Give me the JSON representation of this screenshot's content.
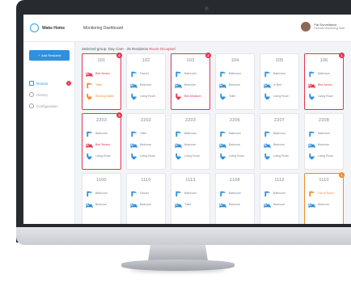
{
  "colors": {
    "accent": "#2f90dd",
    "alert": "#e8344e",
    "warning": "#f28a2b"
  },
  "header": {
    "logo_text": "Wake Home",
    "title": "Monitoring Dashboard",
    "user_name": "Pat Surveilance",
    "user_role": "Remote Monitoring Staff"
  },
  "sidebar": {
    "add_button": "Add Resident",
    "items": [
      {
        "label": "Rooms",
        "badge": "1",
        "icon": "grid-icon"
      },
      {
        "label": "History",
        "icon": "clock-icon"
      },
      {
        "label": "Configuration",
        "icon": "gear-icon"
      }
    ]
  },
  "main": {
    "filter_text": "Selected group: Day Care · 25 Residents",
    "filter_link": "Room Occupied"
  },
  "rooms": [
    {
      "number": "101",
      "status": "alert",
      "badge": "3",
      "devices": [
        {
          "icon": "bed-icon",
          "label": "Bed Sensor",
          "tone": "red"
        },
        {
          "icon": "faucet-icon",
          "label": "Toilet",
          "tone": "orange"
        },
        {
          "icon": "toilet-icon",
          "label": "Running Water",
          "tone": "orange"
        }
      ]
    },
    {
      "number": "102",
      "status": "normal",
      "devices": [
        {
          "icon": "faucet-icon",
          "label": "Faucet"
        },
        {
          "icon": "bed-icon",
          "label": "Bedroom"
        },
        {
          "icon": "toilet-icon",
          "label": "Living Room"
        }
      ]
    },
    {
      "number": "103",
      "status": "alert",
      "badge": "2",
      "devices": [
        {
          "icon": "faucet-icon",
          "label": "Bathroom"
        },
        {
          "icon": "bed-icon",
          "label": "Bedroom"
        },
        {
          "icon": "toilet-icon",
          "label": "Bed Moisture",
          "tone": "red"
        }
      ]
    },
    {
      "number": "104",
      "status": "normal",
      "devices": [
        {
          "icon": "faucet-icon",
          "label": "Bathroom"
        },
        {
          "icon": "bed-icon",
          "label": "Bedroom"
        },
        {
          "icon": "toilet-icon",
          "label": "Toilet"
        }
      ]
    },
    {
      "number": "105",
      "status": "normal",
      "devices": [
        {
          "icon": "faucet-icon",
          "label": "Bathroom"
        },
        {
          "icon": "bed-icon",
          "label": "In Bed"
        },
        {
          "icon": "toilet-icon",
          "label": "Living Room"
        }
      ]
    },
    {
      "number": "106",
      "status": "alert",
      "badge": "1",
      "devices": [
        {
          "icon": "faucet-icon",
          "label": "Bathroom"
        },
        {
          "icon": "bed-icon",
          "label": "Bed Sensor",
          "tone": "red"
        },
        {
          "icon": "toilet-icon",
          "label": "Living Room"
        }
      ]
    },
    {
      "number": "2203",
      "status": "alert",
      "badge": "2",
      "devices": [
        {
          "icon": "faucet-icon",
          "label": "Bathroom"
        },
        {
          "icon": "bed-icon",
          "label": "Bed Sensor",
          "tone": "red"
        },
        {
          "icon": "toilet-icon",
          "label": "Living Room"
        }
      ]
    },
    {
      "number": "2202",
      "status": "normal",
      "devices": [
        {
          "icon": "faucet-icon",
          "label": "Toilet"
        },
        {
          "icon": "bed-icon",
          "label": "Bedroom"
        },
        {
          "icon": "toilet-icon",
          "label": "Living Room"
        }
      ]
    },
    {
      "number": "2203",
      "status": "normal",
      "devices": [
        {
          "icon": "faucet-icon",
          "label": "Bathroom"
        },
        {
          "icon": "bed-icon",
          "label": "Bedroom"
        },
        {
          "icon": "toilet-icon",
          "label": "Living Room"
        }
      ]
    },
    {
      "number": "2206",
      "status": "normal",
      "devices": [
        {
          "icon": "faucet-icon",
          "label": "Bathroom"
        },
        {
          "icon": "bed-icon",
          "label": "Bedroom"
        },
        {
          "icon": "toilet-icon",
          "label": "Living Room"
        }
      ]
    },
    {
      "number": "2207",
      "status": "normal",
      "devices": [
        {
          "icon": "faucet-icon",
          "label": "Bathroom"
        },
        {
          "icon": "bed-icon",
          "label": "Bedroom"
        },
        {
          "icon": "toilet-icon",
          "label": "Living Room"
        }
      ]
    },
    {
      "number": "2208",
      "status": "normal",
      "devices": [
        {
          "icon": "faucet-icon",
          "label": "Bathroom"
        },
        {
          "icon": "bed-icon",
          "label": "Bedroom"
        },
        {
          "icon": "toilet-icon",
          "label": "Living Room"
        }
      ]
    },
    {
      "number": "1100",
      "status": "normal",
      "devices": [
        {
          "icon": "faucet-icon",
          "label": "Bathroom"
        },
        {
          "icon": "bed-icon",
          "label": "Bedroom"
        }
      ]
    },
    {
      "number": "1110",
      "status": "normal",
      "devices": [
        {
          "icon": "faucet-icon",
          "label": "Faucet"
        },
        {
          "icon": "bed-icon",
          "label": "Bedroom"
        }
      ]
    },
    {
      "number": "1113",
      "status": "normal",
      "devices": [
        {
          "icon": "faucet-icon",
          "label": "Bathroom"
        },
        {
          "icon": "bed-icon",
          "label": "Toilet"
        }
      ]
    },
    {
      "number": "1108",
      "status": "normal",
      "devices": [
        {
          "icon": "faucet-icon",
          "label": "Bathroom"
        },
        {
          "icon": "bed-icon",
          "label": "Bedroom"
        }
      ]
    },
    {
      "number": "1112",
      "status": "normal",
      "devices": [
        {
          "icon": "faucet-icon",
          "label": "Bathroom"
        },
        {
          "icon": "bed-icon",
          "label": "Bedroom"
        }
      ]
    },
    {
      "number": "1110",
      "status": "warn",
      "badge": "1",
      "devices": [
        {
          "icon": "faucet-icon",
          "label": "Out of Room",
          "tone": "orange"
        },
        {
          "icon": "bed-icon",
          "label": "Bedroom"
        }
      ]
    }
  ]
}
